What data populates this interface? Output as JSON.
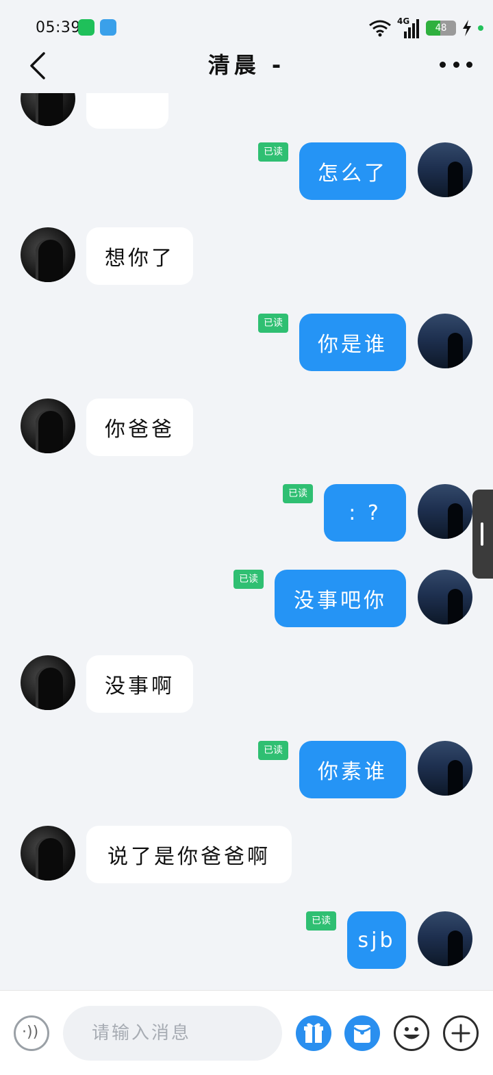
{
  "status_bar": {
    "time": "05:39",
    "network": "4G",
    "battery_percent": "48",
    "battery_level": 0.48,
    "icons": [
      "wechat-icon",
      "notification-app-icon",
      "wifi-icon",
      "signal-icon",
      "battery-icon",
      "charging-icon"
    ]
  },
  "header": {
    "title": "清晨 -",
    "back_icon": "chevron-left-icon",
    "more_icon": "more-dots-icon"
  },
  "colors": {
    "outgoing_bubble": "#2594f5",
    "incoming_bubble": "#ffffff",
    "read_badge": "#2fbf72",
    "background": "#f2f4f7"
  },
  "messages": [
    {
      "side": "left",
      "text": "",
      "read": ""
    },
    {
      "side": "right",
      "text": "怎么了",
      "read": "已读"
    },
    {
      "side": "left",
      "text": "想你了",
      "read": ""
    },
    {
      "side": "right",
      "text": "你是谁",
      "read": "已读"
    },
    {
      "side": "left",
      "text": "你爸爸",
      "read": ""
    },
    {
      "side": "right",
      "text": ": ?",
      "read": "已读"
    },
    {
      "side": "right",
      "text": "没事吧你",
      "read": "已读"
    },
    {
      "side": "left",
      "text": "没事啊",
      "read": ""
    },
    {
      "side": "right",
      "text": "你素谁",
      "read": "已读"
    },
    {
      "side": "left",
      "text": "说了是你爸爸啊",
      "read": ""
    },
    {
      "side": "right",
      "text": "sjb",
      "read": "已读"
    }
  ],
  "input_bar": {
    "placeholder": "请输入消息",
    "value": "",
    "voice_icon": "voice-icon",
    "gift_icon": "gift-icon",
    "red_packet_icon": "red-packet-icon",
    "emoji_icon": "emoji-icon",
    "plus_icon": "plus-icon"
  }
}
